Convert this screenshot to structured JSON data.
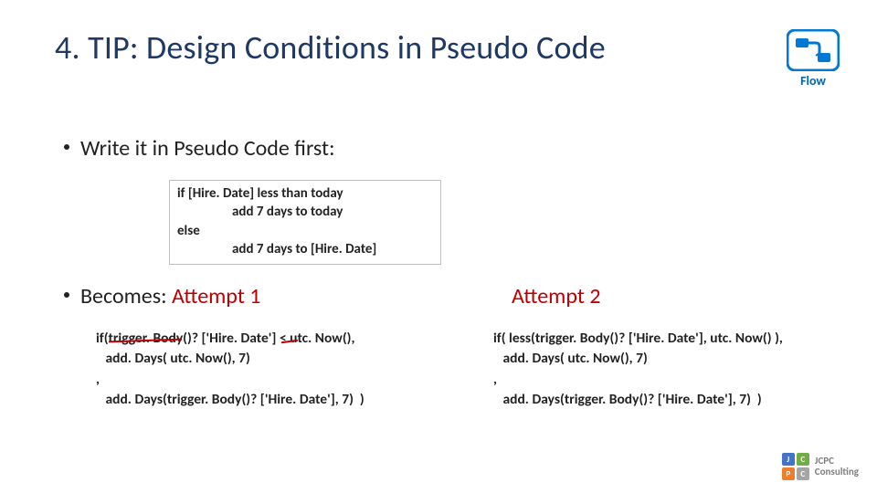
{
  "title": "4. TIP: Design Conditions in Pseudo Code",
  "logo_flow_label": "Flow",
  "bullet1": "Write it in Pseudo Code first:",
  "pseudo": {
    "l1": "if [Hire. Date]  less than today",
    "l2": "add 7 days to today",
    "l3": "else",
    "l4": "add 7 days to [Hire. Date]"
  },
  "bullet2_prefix": "Becomes: ",
  "attempt1_label": "Attempt 1",
  "attempt2_label": "Attempt 2",
  "code1": {
    "l1": "if(trigger. Body()? ['Hire. Date'] < utc. Now(),",
    "l2": "   add. Days( utc. Now(), 7)",
    "l3": ",",
    "l4": "   add. Days(trigger. Body()? ['Hire. Date'], 7)  )"
  },
  "code2": {
    "l1a": "if( less(trigger. Body()? ['Hire. Date'], utc. Now() ),",
    "l2a": "   ",
    "l2b": "add. Days",
    "l2c": "( utc. Now(), 7)",
    "l3": ",",
    "l4": "   add. Days(trigger. Body()? ['Hire. Date'], 7)  )"
  },
  "footer": {
    "tiles": {
      "j": "J",
      "c": "C",
      "p": "P",
      "c2": "C"
    },
    "line1": "JCPC",
    "line2": "Consulting"
  }
}
